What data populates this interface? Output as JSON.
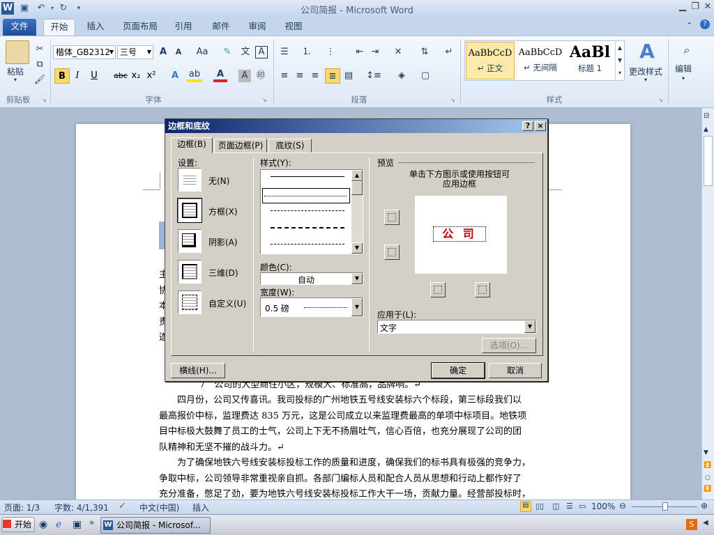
{
  "window": {
    "title": "公司简报 - Microsoft Word"
  },
  "ribbon_tabs": [
    "文件",
    "开始",
    "插入",
    "页面布局",
    "引用",
    "邮件",
    "审阅",
    "视图"
  ],
  "ribbon": {
    "paste_label": "粘贴",
    "font_name": "楷体_GB2312",
    "font_size": "三号",
    "grow_font": "A",
    "shrink_font": "A",
    "change_case": "Aa",
    "bold": "B",
    "italic": "I",
    "underline": "U",
    "strike": "abc",
    "sub": "x₂",
    "sup": "x²",
    "styles": [
      {
        "preview": "AaBbCcD",
        "name": "↵ 正文"
      },
      {
        "preview": "AaBbCcD",
        "name": "↵ 无间隔"
      },
      {
        "preview": "AaBl",
        "name": "标题 1"
      }
    ],
    "change_styles": "更改样式",
    "edit": "编辑",
    "groups": {
      "clipboard": "剪贴板",
      "font": "字体",
      "paragraph": "段落",
      "styles": "样式"
    }
  },
  "document": {
    "line_partial": "7　公司的大型商住小区，规模大、标准高，品牌响。↵",
    "para1": [
      "　　四月份，公司又传喜讯。我司投标的广州地铁五号线安装标六个标段，第三标段我们以",
      "最高报价中标，监理费达 835 万元，这是公司成立以来监理费最高的单项中标项目。地铁项",
      "目中标极大鼓舞了员工的士气，公司上下无不扬眉吐气，信心百倍，也充分展现了公司的团",
      "队精神和无坚不摧的战斗力。↵"
    ],
    "para2": [
      "　　为了确保地铁六号线安装标投标工作的质量和进度，确保我们的标书具有极强的竞争力，",
      "争取中标，公司领导非常重视亲自抓。各部门编标人员和配合人员从思想和行动上都作好了",
      "充分准备，憋足了劲，要为地铁六号线安装标投标工作大干一场，贡献力量。经营部投标时，"
    ],
    "left_chars": [
      "主",
      "协",
      "本",
      "责",
      "遂"
    ]
  },
  "dialog": {
    "title": "边框和底纹",
    "help": "?",
    "close": "×",
    "tabs": [
      "边框(B)",
      "页面边框(P)",
      "底纹(S)"
    ],
    "settings_label": "设置:",
    "settings": [
      "无(N)",
      "方框(X)",
      "阴影(A)",
      "三维(D)",
      "自定义(U)"
    ],
    "style_label": "样式(Y):",
    "color_label": "颜色(C):",
    "color_value": "自动",
    "width_label": "宽度(W):",
    "width_value": "0.5 磅",
    "preview_label": "预览",
    "preview_hint": [
      "单击下方图示或使用按钮可",
      "应用边框"
    ],
    "preview_text": "公 司",
    "apply_label": "应用于(L):",
    "apply_value": "文字",
    "options_btn": "选项(O)...",
    "hline_btn": "横线(H)...",
    "ok_btn": "确定",
    "cancel_btn": "取消"
  },
  "status": {
    "page": "页面: 1/3",
    "words": "字数: 4/1,391",
    "lang": "中文(中国)",
    "mode": "插入",
    "zoom": "100%"
  },
  "taskbar": {
    "start": "开始",
    "task": "公司简报 - Microsof..."
  }
}
